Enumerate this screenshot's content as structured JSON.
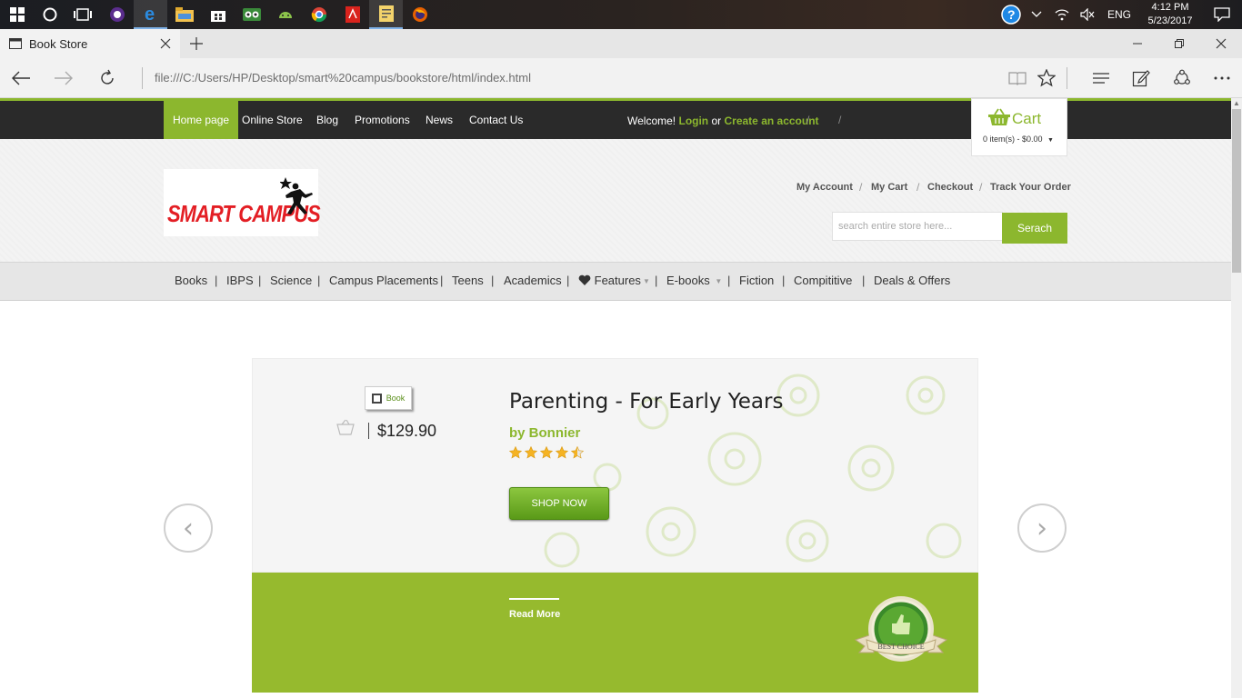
{
  "taskbar": {
    "apps": [
      {
        "icon": "windows-start-icon"
      },
      {
        "icon": "cortana-icon"
      },
      {
        "icon": "task-view-icon"
      },
      {
        "icon": "app-purple-icon"
      },
      {
        "icon": "edge-icon"
      },
      {
        "icon": "file-explorer-icon"
      },
      {
        "icon": "store-icon"
      },
      {
        "icon": "tripadvisor-icon"
      },
      {
        "icon": "android-icon"
      },
      {
        "icon": "chrome-icon"
      },
      {
        "icon": "acrobat-icon"
      },
      {
        "icon": "notepad-icon"
      },
      {
        "icon": "firefox-icon"
      }
    ],
    "language": "ENG",
    "time": "4:12 PM",
    "date": "5/23/2017"
  },
  "browser": {
    "tab_title": "Book Store",
    "url": "file:///C:/Users/HP/Desktop/smart%20campus/bookstore/html/index.html"
  },
  "site": {
    "accent": "#8cb72e",
    "topnav": {
      "items": [
        "Home page",
        "Online Store",
        "Blog",
        "Promotions",
        "News",
        "Contact Us"
      ],
      "active": "Home page"
    },
    "welcome": {
      "text": "Welcome!",
      "login": "Login",
      "or": "or",
      "create": "Create an account"
    },
    "cart": {
      "title": "Cart",
      "summary": "0 item(s) - $0.00"
    },
    "logo_text": "SMART CAMPUS",
    "account_links": [
      "My Account",
      "My Cart",
      "Checkout",
      "Track Your Order"
    ],
    "search": {
      "placeholder": "search entire store here...",
      "button": "Serach"
    },
    "categories": [
      "Books",
      "IBPS",
      "Science",
      "Campus Placements",
      "Teens",
      "Academics",
      "Features",
      "E-books",
      "Fiction",
      "Compititive",
      "Deals & Offers"
    ],
    "slide": {
      "tag": "Book",
      "price": "$129.90",
      "title": "Parenting - For Early Years",
      "author": "by Bonnier",
      "rating": 4.5,
      "rating_max": 5,
      "shop_button": "SHOP NOW",
      "read_more": "Read More",
      "badge_text": "BEST CHOICE"
    }
  }
}
